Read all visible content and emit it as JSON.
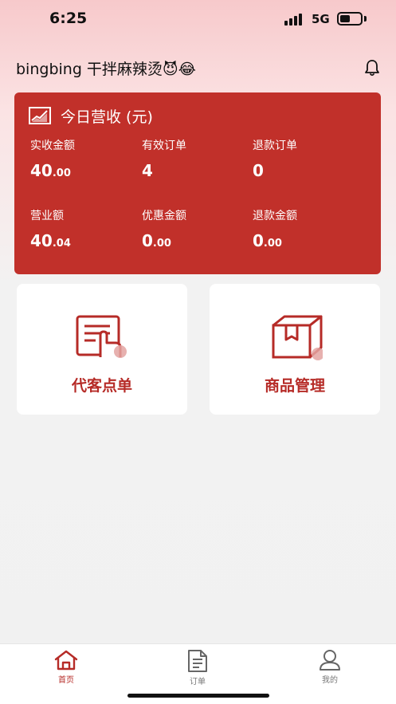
{
  "status_bar": {
    "time": "6:25",
    "network": "5G",
    "battery_level": 0.5
  },
  "header": {
    "store_name": "bingbing 干拌麻辣烫😈😂",
    "bell_icon": "bell-icon"
  },
  "revenue_card": {
    "title": "今日营收 (元)",
    "title_icon": "chart-icon",
    "background_color": "#c1302a",
    "metrics": [
      {
        "label": "实收金额",
        "int": "40",
        "dec": ".00"
      },
      {
        "label": "有效订单",
        "int": "4",
        "dec": ""
      },
      {
        "label": "退款订单",
        "int": "0",
        "dec": ""
      },
      {
        "label": "营业额",
        "int": "40",
        "dec": ".04"
      },
      {
        "label": "优惠金额",
        "int": "0",
        "dec": ".00"
      },
      {
        "label": "退款金额",
        "int": "0",
        "dec": ".00"
      }
    ]
  },
  "actions": [
    {
      "label": "代客点单",
      "icon": "order-for-customer-icon"
    },
    {
      "label": "商品管理",
      "icon": "product-box-icon"
    }
  ],
  "tabbar": {
    "active_color": "#b62b27",
    "items": [
      {
        "label": "首页",
        "icon": "home-icon",
        "active": true
      },
      {
        "label": "订单",
        "icon": "order-icon",
        "active": false
      },
      {
        "label": "我的",
        "icon": "profile-icon",
        "active": false
      }
    ]
  }
}
